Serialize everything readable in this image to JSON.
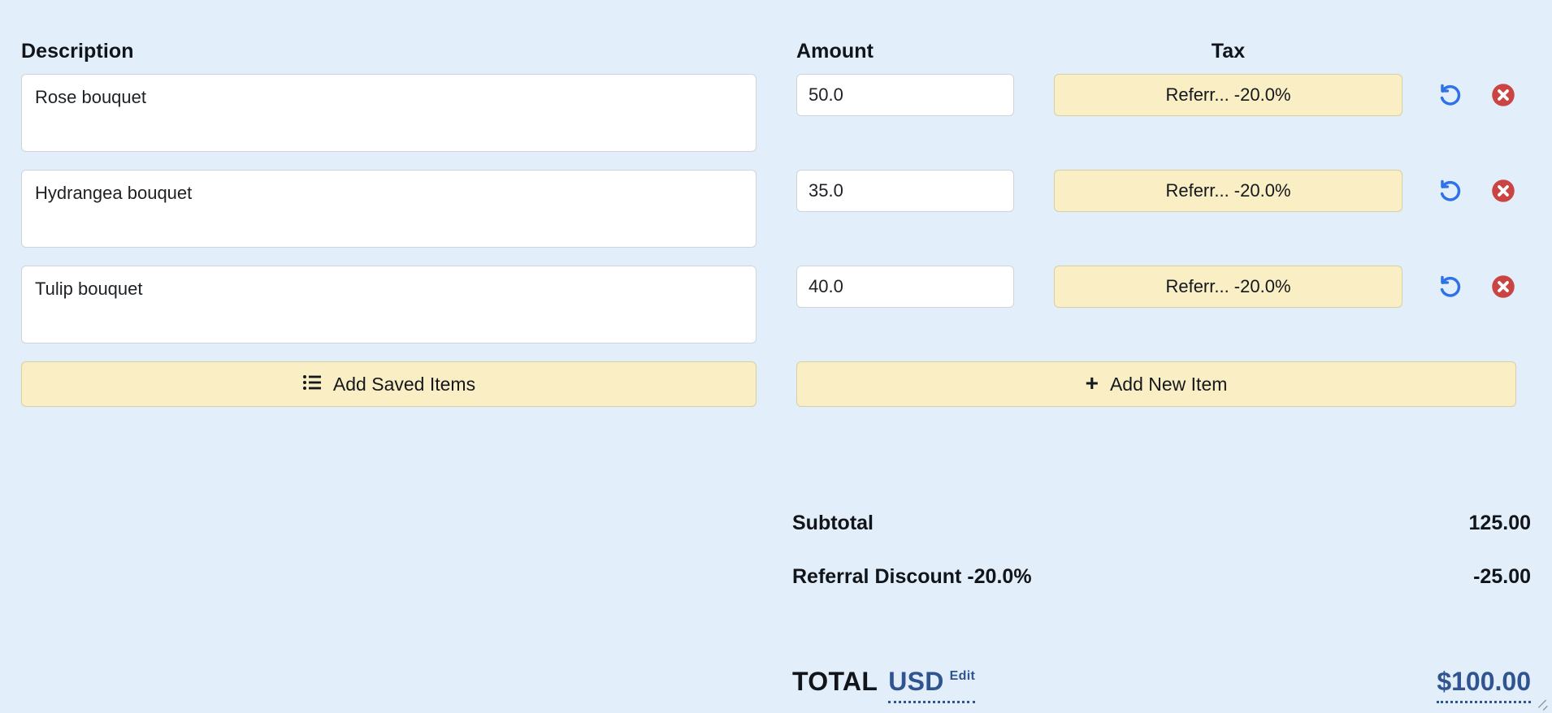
{
  "headers": {
    "description": "Description",
    "amount": "Amount",
    "tax": "Tax"
  },
  "items": [
    {
      "description": "Rose bouquet",
      "amount": "50.0",
      "tax_label": "Referr... -20.0%"
    },
    {
      "description": "Hydrangea bouquet",
      "amount": "35.0",
      "tax_label": "Referr... -20.0%"
    },
    {
      "description": "Tulip bouquet",
      "amount": "40.0",
      "tax_label": "Referr... -20.0%"
    }
  ],
  "actions": {
    "reset_icon": "undo-icon",
    "delete_icon": "delete-circle-icon",
    "add_saved_items": "Add Saved Items",
    "add_saved_icon": "list-icon",
    "add_new_item": "Add New Item",
    "add_new_icon": "plus-icon"
  },
  "totals": {
    "subtotal_label": "Subtotal",
    "subtotal_value": "125.00",
    "discount_label": "Referral Discount -20.0%",
    "discount_value": "-25.00",
    "total_label": "TOTAL",
    "currency": "USD",
    "edit_label": "Edit",
    "total_value": "$100.00"
  },
  "colors": {
    "background": "#e3eefb",
    "accent_yellow": "#faeec4",
    "accent_yellow_border": "#d8cfa3",
    "link_blue": "#2f5490",
    "undo_blue": "#2f72e8",
    "delete_red": "#cb4444"
  }
}
